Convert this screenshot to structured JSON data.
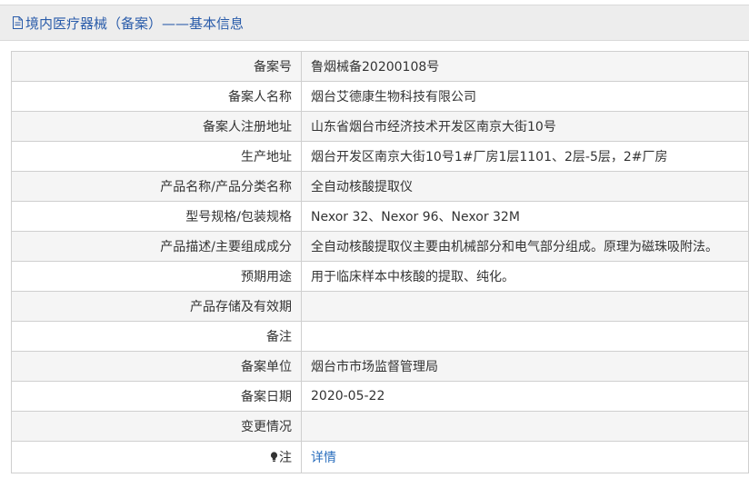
{
  "header": {
    "title": "境内医疗器械（备案）——基本信息",
    "icon": "document-icon"
  },
  "rows": [
    {
      "label": "备案号",
      "value": "鲁烟械备20200108号"
    },
    {
      "label": "备案人名称",
      "value": "烟台艾德康生物科技有限公司"
    },
    {
      "label": "备案人注册地址",
      "value": "山东省烟台市经济技术开发区南京大街10号"
    },
    {
      "label": "生产地址",
      "value": "烟台开发区南京大街10号1#厂房1层1101、2层-5层，2#厂房"
    },
    {
      "label": "产品名称/产品分类名称",
      "value": "全自动核酸提取仪"
    },
    {
      "label": "型号规格/包装规格",
      "value": "Nexor 32、Nexor 96、Nexor 32M"
    },
    {
      "label": "产品描述/主要组成成分",
      "value": "全自动核酸提取仪主要由机械部分和电气部分组成。原理为磁珠吸附法。"
    },
    {
      "label": "预期用途",
      "value": "用于临床样本中核酸的提取、纯化。"
    },
    {
      "label": "产品存储及有效期",
      "value": ""
    },
    {
      "label": "备注",
      "value": ""
    },
    {
      "label": "备案单位",
      "value": "烟台市市场监督管理局"
    },
    {
      "label": "备案日期",
      "value": "2020-05-22"
    },
    {
      "label": "变更情况",
      "value": ""
    }
  ],
  "note_row": {
    "label": "注",
    "icon": "lightbulb-icon",
    "link_text": "详情"
  },
  "colors": {
    "title": "#2a5caa",
    "link": "#2a6ebd",
    "border": "#cfcfcf",
    "stripe": "#f5f5f5",
    "header_bg": "#ededed"
  }
}
